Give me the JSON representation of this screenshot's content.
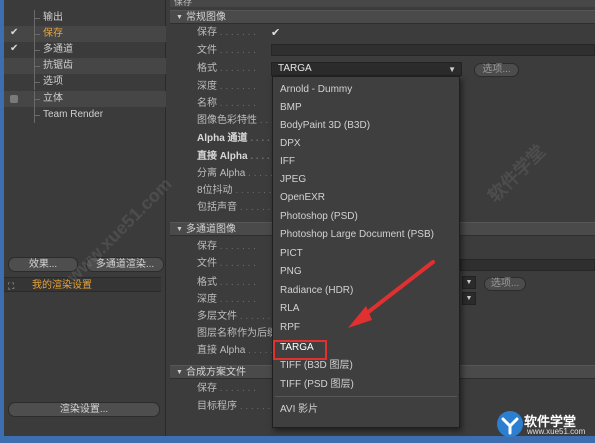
{
  "left_tree": [
    {
      "label": "输出",
      "check": ""
    },
    {
      "label": "保存",
      "check": "✔",
      "selected": true
    },
    {
      "label": "多通道",
      "check": "✔"
    },
    {
      "label": "抗锯齿",
      "check": ""
    },
    {
      "label": "选项",
      "check": ""
    },
    {
      "label": "立体",
      "check": "square"
    },
    {
      "label": "Team Render",
      "check": ""
    }
  ],
  "left_buttons": {
    "effects": "效果...",
    "multipass_render": "多通道渲染...",
    "render_settings": "渲染设置..."
  },
  "render_setting_row": {
    "icon": "⛶",
    "label": "我的渲染设置"
  },
  "top_tab_label": "保存",
  "section_regular": "常规图像",
  "section_multipass": "多通道图像",
  "section_compositing": "合成方案文件",
  "regular_props": [
    "保存",
    "文件",
    "格式",
    "深度",
    "名称",
    "图像色彩特性",
    "Alpha 通道",
    "直接 Alpha",
    "分离 Alpha",
    "8位抖动",
    "包括声音"
  ],
  "multipass_props": [
    "保存",
    "文件",
    "格式",
    "深度",
    "多层文件",
    "图层名称作为后缀",
    "直接 Alpha"
  ],
  "compositing_props": [
    "保存",
    "目标程序"
  ],
  "format_value": "TARGA",
  "options_button": "选项...",
  "options_button_2": "选项...",
  "dropdown_items": [
    "Arnold - Dummy",
    "BMP",
    "BodyPaint 3D (B3D)",
    "DPX",
    "IFF",
    "JPEG",
    "OpenEXR",
    "Photoshop (PSD)",
    "Photoshop Large Document (PSB)",
    "PICT",
    "PNG",
    "Radiance (HDR)",
    "RLA",
    "RPF",
    "TARGA",
    "TIFF (B3D 图层)",
    "TIFF (PSD 图层)",
    "AVI 影片"
  ],
  "watermark_text": "www.xue51.com",
  "watermark_text_2": "软件学堂",
  "logo": {
    "name": "软件学堂",
    "url": "www.xue51.com"
  },
  "colors": {
    "accent_orange": "#e8a33a",
    "highlight_red": "#e03030",
    "frame_blue": "#3d6fb0"
  }
}
